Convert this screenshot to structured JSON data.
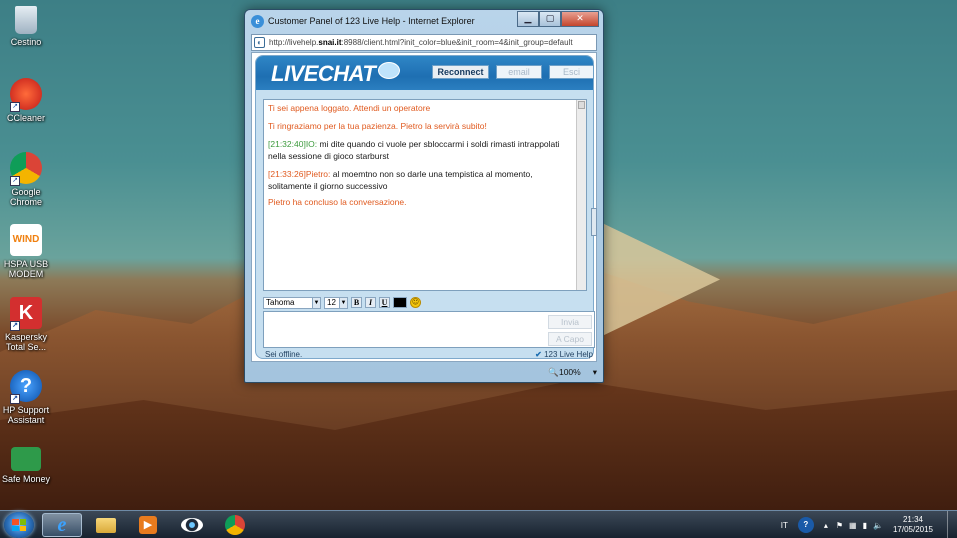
{
  "desktop": {
    "icons": [
      {
        "label": "Cestino",
        "icon": "recycle-bin-icon"
      },
      {
        "label": "CCleaner",
        "icon": "ccleaner-icon"
      },
      {
        "label": "Google\nChrome",
        "icon": "chrome-icon"
      },
      {
        "label": "HSPA USB\nMODEM",
        "icon": "wind-modem-icon"
      },
      {
        "label": "Kaspersky\nTotal Se...",
        "icon": "kaspersky-icon"
      },
      {
        "label": "HP Support\nAssistant",
        "icon": "help-icon"
      },
      {
        "label": "Safe Money",
        "icon": "safe-money-icon"
      }
    ]
  },
  "window": {
    "title": "Customer Panel of 123 Live Help - Internet Explorer",
    "address_prefix": "http://livehelp.",
    "address_domain": "snai.it",
    "address_suffix": ":8988/client.html?init_color=blue&init_room=4&init_group=default",
    "zoom": "100%"
  },
  "chat": {
    "logo": "LIVECHAT",
    "buttons": {
      "reconnect": "Reconnect",
      "email": "email",
      "esci": "Esci"
    },
    "messages": [
      {
        "type": "sys",
        "text": "Ti sei appena loggato. Attendi un operatore"
      },
      {
        "type": "sys",
        "text": "Ti ringraziamo per la tua pazienza. Pietro la servirà subito!"
      },
      {
        "type": "user",
        "time": "[21:32:40]",
        "who": "IO:",
        "text": " mi dite quando ci vuole per sbloccarmi i soldi rimasti intrappolati nella sessione di gioco starburst"
      },
      {
        "type": "op",
        "time": "[21:33:26]",
        "who": "Pietro:",
        "text": " al moemtno non so darle una tempistica al momento, solitamente il giorno successivo"
      },
      {
        "type": "sys",
        "text": "Pietro ha concluso la conversazione."
      }
    ],
    "font": "Tahoma",
    "font_size": "12",
    "format": {
      "bold": "B",
      "italic": "I",
      "underline": "U"
    },
    "send_label": "Invia",
    "newline_label": "A Capo",
    "status": "Sei offline.",
    "brand": "123 Live Help"
  },
  "tray": {
    "lang": "IT",
    "time": "21:34",
    "date": "17/05/2015"
  }
}
